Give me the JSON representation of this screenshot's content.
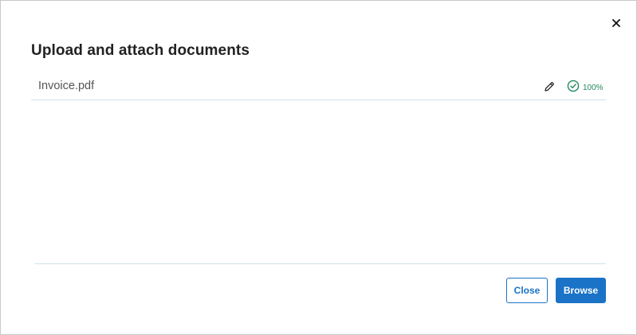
{
  "dialog": {
    "title": "Upload and attach documents"
  },
  "files": [
    {
      "name": "Invoice.pdf",
      "progress_percent": 100,
      "progress_label": "100%",
      "status_icon": "check-circle-icon"
    }
  ],
  "footer": {
    "close_label": "Close",
    "browse_label": "Browse"
  },
  "colors": {
    "accent": "#1a73c7",
    "success": "#1e8a5c",
    "divider": "#cfe3ea",
    "title_text": "#222222"
  }
}
